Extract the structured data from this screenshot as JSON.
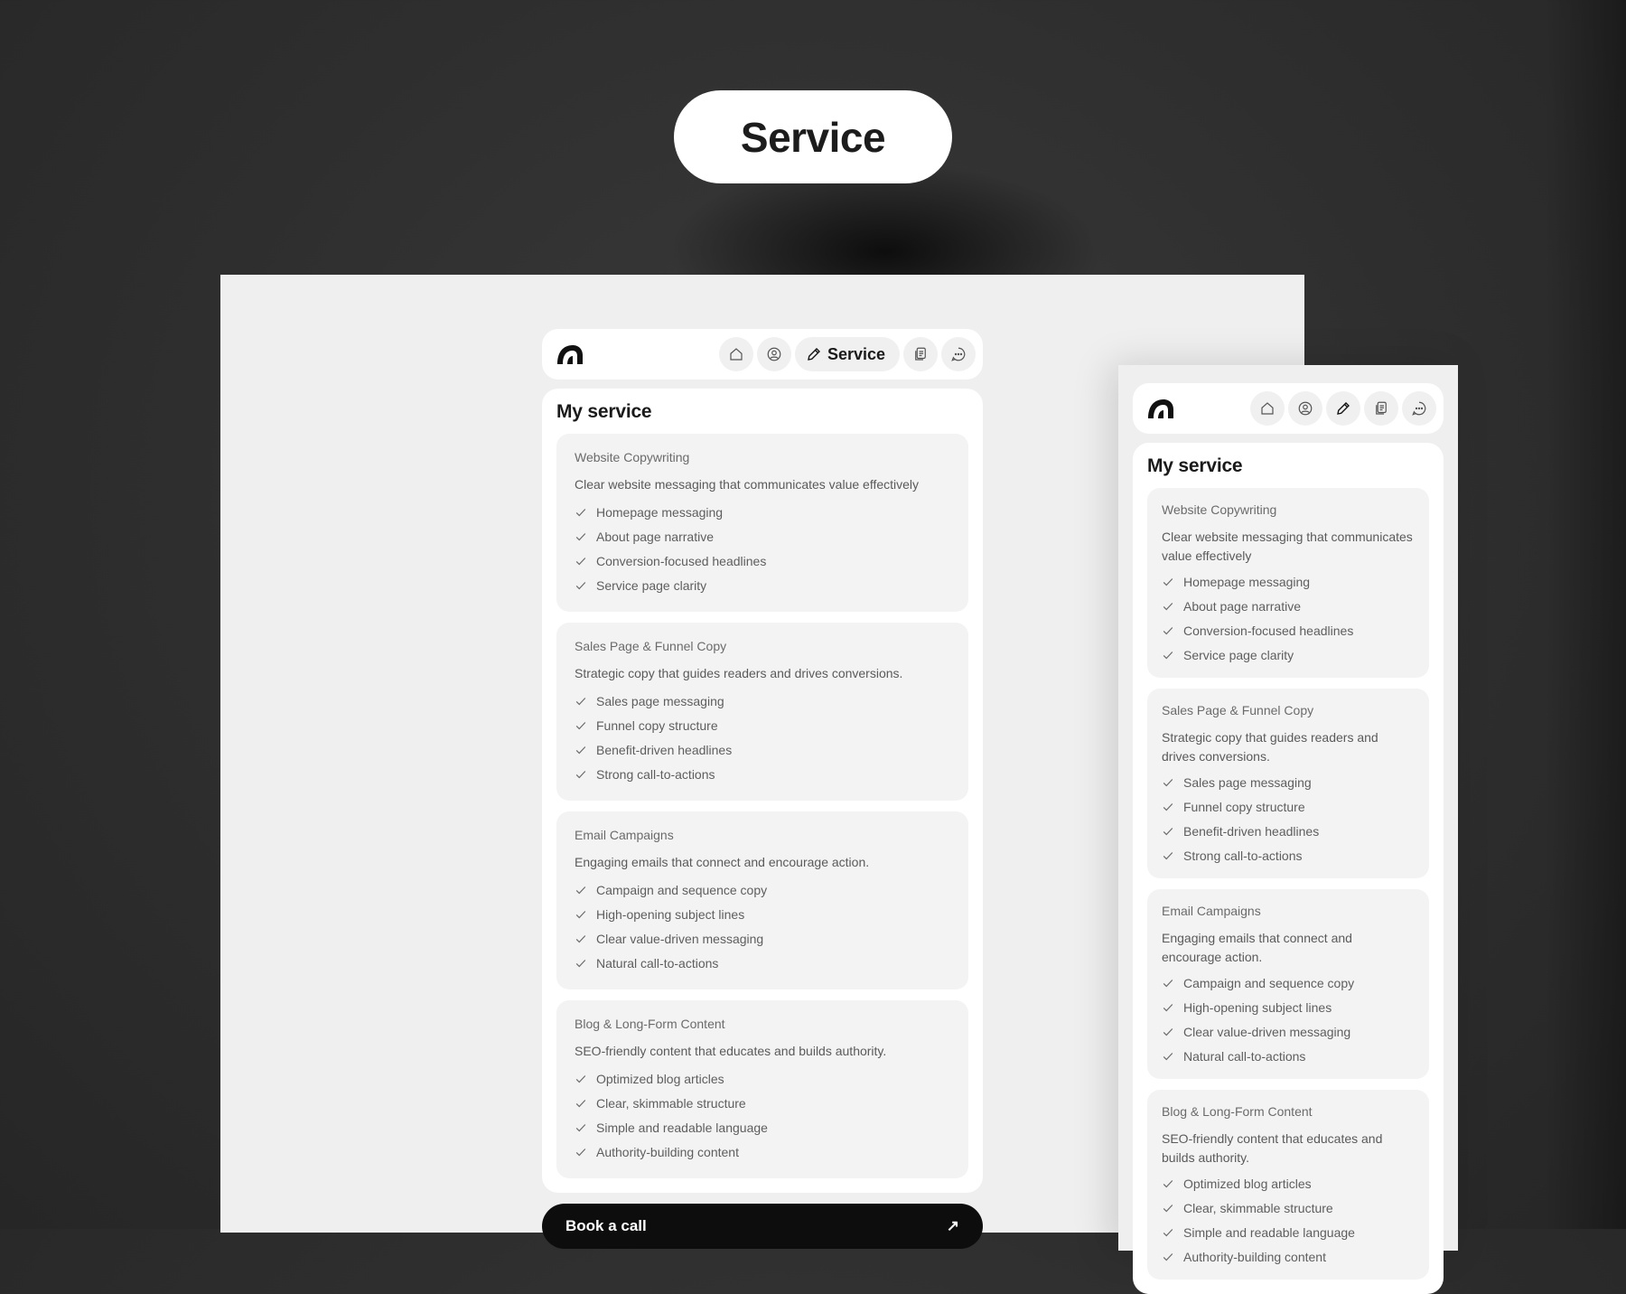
{
  "hero": {
    "title": "Service"
  },
  "nav": {
    "active_label": "Service"
  },
  "section_title": "My service",
  "services": [
    {
      "title": "Website Copywriting",
      "description": "Clear website messaging that communicates value effectively",
      "items": [
        "Homepage messaging",
        "About page narrative",
        "Conversion-focused headlines",
        "Service page clarity"
      ]
    },
    {
      "title": "Sales Page & Funnel Copy",
      "description": "Strategic copy that guides readers and drives conversions.",
      "items": [
        "Sales page messaging",
        "Funnel copy structure",
        "Benefit-driven headlines",
        "Strong call-to-actions"
      ]
    },
    {
      "title": "Email Campaigns",
      "description": "Engaging emails that connect and encourage action.",
      "items": [
        "Campaign and sequence copy",
        "High-opening subject lines",
        "Clear value-driven messaging",
        "Natural call-to-actions"
      ]
    },
    {
      "title": "Blog & Long-Form Content",
      "description": "SEO-friendly content that educates and builds authority.",
      "items": [
        "Optimized blog articles",
        "Clear, skimmable structure",
        "Simple and readable language",
        "Authority-building content"
      ]
    }
  ],
  "cta": {
    "label": "Book a call"
  },
  "icons": [
    "logo-icon",
    "home-icon",
    "user-icon",
    "pencil-icon",
    "document-icon",
    "chat-icon",
    "check-icon"
  ],
  "colors": {
    "background": "#2e2e2e",
    "canvas": "#efefef",
    "card": "#f3f3f4",
    "cta": "#0d0d0d"
  }
}
